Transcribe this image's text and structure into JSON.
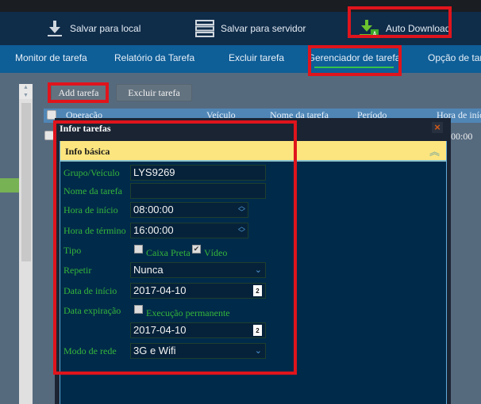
{
  "toolbar": {
    "items": [
      {
        "label": "Salvar para local",
        "icon": "download-icon"
      },
      {
        "label": "Salvar para servidor",
        "icon": "server-icon"
      },
      {
        "label": "Auto Download",
        "icon": "auto-download-icon",
        "badge": "A"
      }
    ]
  },
  "nav": {
    "items": [
      {
        "label": "Monitor de tarefa"
      },
      {
        "label": "Relatório da Tarefa"
      },
      {
        "label": "Excluir tarefa"
      },
      {
        "label": "Gerenciador de tarefa",
        "active": true
      },
      {
        "label": "Opção de tare"
      }
    ]
  },
  "actions": {
    "add": "Add tarefa",
    "delete": "Excluir tarefa"
  },
  "table": {
    "columns": [
      "Operação",
      "Veículo",
      "Nome da tarefa",
      "Período",
      "Hora de iníc"
    ],
    "rows": [
      {
        "start": "00:00"
      }
    ]
  },
  "dialog": {
    "title": "Infor tarefas",
    "close": "×",
    "section": "Info básica",
    "fields": {
      "group_label": "Grupo/Veículo",
      "group_value": "LYS9269",
      "name_label": "Nome da tarefa",
      "name_value": "",
      "start_time_label": "Hora de início",
      "start_time_value": "08:00:00",
      "end_time_label": "Hora de término",
      "end_time_value": "16:00:00",
      "type_label": "Tipo",
      "type_blackbox": "Caixa Preta",
      "type_blackbox_checked": false,
      "type_video": "Vídeo",
      "type_video_checked": true,
      "repeat_label": "Repetir",
      "repeat_value": "Nunca",
      "start_date_label": "Data de início",
      "start_date_value": "2017-04-10",
      "expiry_label": "Data expiração",
      "permanent_label": "Execução permanente",
      "permanent_checked": false,
      "expiry_value": "2017-04-10",
      "network_label": "Modo de rede",
      "network_value": "3G e Wifi"
    }
  },
  "colors": {
    "highlight": "#e0141c",
    "accent_green": "#36c24a",
    "section_yellow": "#fce57e"
  }
}
